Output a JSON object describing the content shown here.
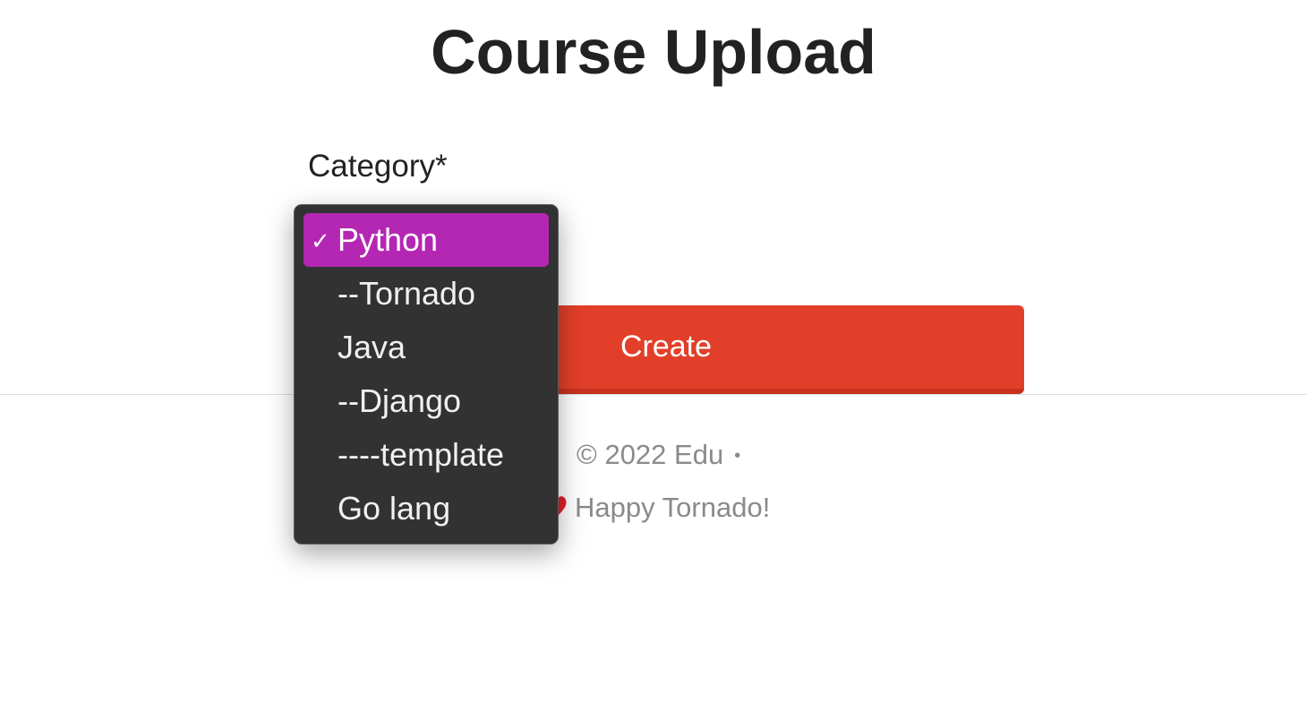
{
  "page": {
    "title": "Course Upload"
  },
  "form": {
    "category_label": "Category*",
    "category_select": {
      "selected": "Python",
      "options": [
        {
          "label": "Python",
          "selected": true
        },
        {
          "label": "--Tornado",
          "selected": false
        },
        {
          "label": "Java",
          "selected": false
        },
        {
          "label": "--Django",
          "selected": false
        },
        {
          "label": "----template",
          "selected": false
        },
        {
          "label": "Go lang",
          "selected": false
        }
      ],
      "check_glyph": "✓"
    },
    "create_label": "Create"
  },
  "footer": {
    "copyright": "© 2022 Edu",
    "separator": "•",
    "tagline": "Happy Tornado!",
    "heart_icon": "heart-icon"
  },
  "colors": {
    "accent": "#e13f29",
    "selection": "#b427b3",
    "dropdown_bg": "#323232"
  }
}
